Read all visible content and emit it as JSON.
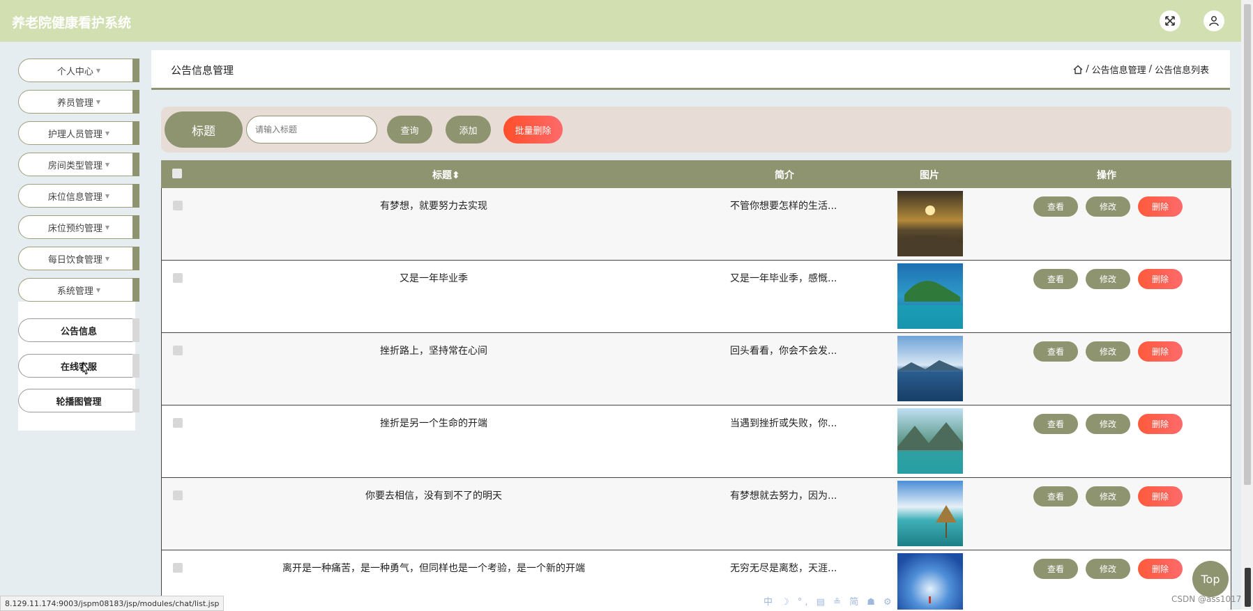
{
  "app": {
    "title": "养老院健康看护系统"
  },
  "header_icons": {
    "fullscreen": "fullscreen-icon",
    "user": "user-icon"
  },
  "sidebar": {
    "items": [
      {
        "label": "个人中心"
      },
      {
        "label": "养员管理"
      },
      {
        "label": "护理人员管理"
      },
      {
        "label": "房间类型管理"
      },
      {
        "label": "床位信息管理"
      },
      {
        "label": "床位预约管理"
      },
      {
        "label": "每日饮食管理"
      },
      {
        "label": "系统管理"
      }
    ],
    "submenu": [
      {
        "label": "公告信息"
      },
      {
        "label": "在线客服"
      },
      {
        "label": "轮播图管理"
      }
    ]
  },
  "page": {
    "title": "公告信息管理",
    "breadcrumb": [
      "公告信息管理",
      "公告信息列表"
    ],
    "separator": "/"
  },
  "search": {
    "label": "标题",
    "placeholder": "请输入标题",
    "query_btn": "查询",
    "add_btn": "添加",
    "batch_delete_btn": "批量删除"
  },
  "table": {
    "headers": {
      "title": "标题",
      "sort_icon": "⬍",
      "intro": "简介",
      "image": "图片",
      "actions": "操作"
    },
    "actions": {
      "view": "查看",
      "edit": "修改",
      "delete": "删除"
    },
    "rows": [
      {
        "title": "有梦想，就要努力去实现",
        "intro": "不管你想要怎样的生活..."
      },
      {
        "title": "又是一年毕业季",
        "intro": "又是一年毕业季，感慨..."
      },
      {
        "title": "挫折路上，坚持常在心间",
        "intro": "回头看看，你会不会发..."
      },
      {
        "title": "挫折是另一个生命的开端",
        "intro": "当遇到挫折或失败，你..."
      },
      {
        "title": "你要去相信，没有到不了的明天",
        "intro": "有梦想就去努力，因为..."
      },
      {
        "title": "离开是一种痛苦，是一种勇气，但同样也是一个考验，是一个新的开端",
        "intro": "无穷无尽是离愁，天涯..."
      }
    ]
  },
  "float": {
    "top_btn": "Top"
  },
  "status": {
    "url": "8.129.11.174:9003/jspm08183/jsp/modules/chat/list.jsp"
  },
  "watermark": "CSDN @ass1017",
  "ime_toolbar": "中 ☽ °, ▤ ≗ 简 ☗ ⚙",
  "colors": {
    "primary": "#8e9470",
    "header": "#d2dfb0",
    "danger": "#ff5a3c",
    "panel": "#e8dcd6"
  }
}
